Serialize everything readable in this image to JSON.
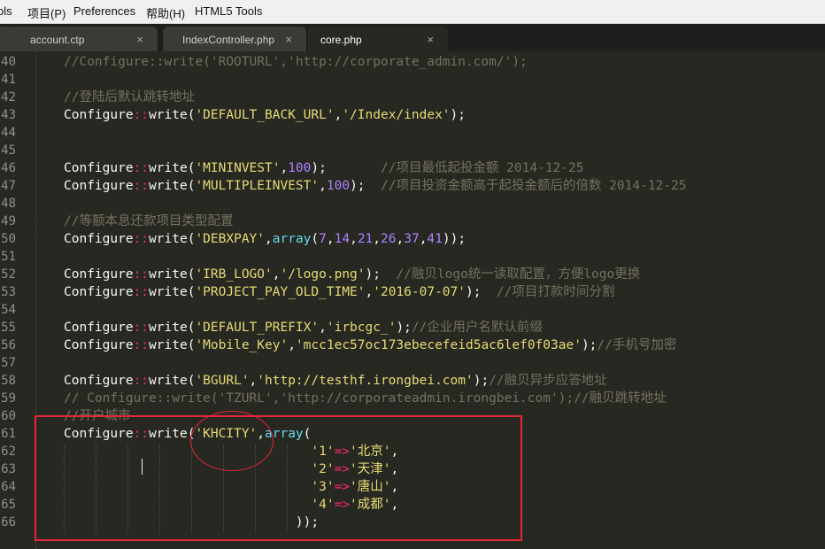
{
  "menubar": {
    "items": [
      "ols",
      "项目(P)",
      "Preferences",
      "帮助(H)",
      "HTML5 Tools"
    ]
  },
  "tabs": [
    {
      "label": "account.ctp",
      "close": "×",
      "active": false
    },
    {
      "label": "IndexController.php",
      "close": "×",
      "active": false
    },
    {
      "label": "core.php",
      "close": "×",
      "active": true
    }
  ],
  "editor": {
    "line_numbers": [
      "40",
      "41",
      "42",
      "43",
      "44",
      "45",
      "46",
      "47",
      "48",
      "49",
      "50",
      "51",
      "52",
      "53",
      "54",
      "55",
      "56",
      "57",
      "58",
      "59",
      "60",
      "61",
      "62",
      "63",
      "64",
      "65",
      "66"
    ],
    "lines": [
      "//Configure::write('ROOTURL','http://corporate_admin.com/');",
      "",
      "//登陆后默认跳转地址",
      "Configure::write('DEFAULT_BACK_URL','/Index/index');",
      "",
      "",
      "Configure::write('MININVEST',100);       //项目最低起投金额 2014-12-25",
      "Configure::write('MULTIPLEINVEST',100);  //项目投资金额高于起投金额后的倍数 2014-12-25",
      "",
      "//等额本息还款项目类型配置",
      "Configure::write('DEBXPAY',array(7,14,21,26,37,41));",
      "",
      "Configure::write('IRB_LOGO','/logo.png');  //融贝logo统一读取配置，方便logo更换",
      "Configure::write('PROJECT_PAY_OLD_TIME','2016-07-07');  //项目打款时间分割",
      "",
      "Configure::write('DEFAULT_PREFIX','irbcgc_');//企业用户名默认前缀",
      "Configure::write('Mobile_Key','mcc1ec57oc173ebecefeid5ac6lef0f03ae');//手机号加密",
      "",
      "Configure::write('BGURL','http://testhf.irongbei.com');//融贝异步应答地址",
      "// Configure::write('TZURL','http://corporateadmin.irongbei.com');//融贝跳转地址",
      "//开户城市",
      "Configure::write('KHCITY',array(",
      "                                '1'=>'北京',",
      "                                '2'=>'天津',",
      "                                '3'=>'唐山',",
      "                                '4'=>'成都',",
      "                              ));"
    ]
  },
  "colors": {
    "background": "#272822",
    "comment": "#75715e",
    "string": "#e6db74",
    "number": "#ae81ff",
    "operator": "#f92672",
    "function": "#66d9ef",
    "annotation": "#e4283a"
  }
}
